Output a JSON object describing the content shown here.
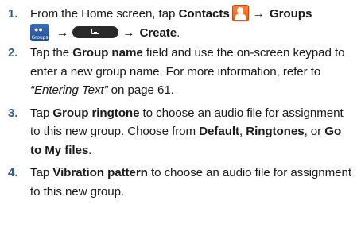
{
  "steps": [
    {
      "number": "1.",
      "from": "From the Home screen, tap ",
      "contacts": "Contacts",
      "arrow": "→",
      "groups": "Groups",
      "groups_icon_label": "Groups",
      "create": "Create",
      "end": "."
    },
    {
      "number": "2.",
      "tap": "Tap the ",
      "field": "Group name",
      "rest": " field and use the on-screen keypad to enter a new group name. For more information, refer to ",
      "ref": "“Entering Text”",
      "page": " on page 61."
    },
    {
      "number": "3.",
      "tap": "Tap ",
      "ringtone": "Group ringtone",
      "rest": " to choose an audio file for assignment to this new group. Choose from ",
      "default": "Default",
      "comma": ",",
      "ringtones": "Ringtones",
      "or": ", or ",
      "myfiles": "Go to My files",
      "end": "."
    },
    {
      "number": "4.",
      "tap": "Tap ",
      "vibration": "Vibration pattern",
      "rest": " to choose an audio file for assignment to this new group."
    }
  ],
  "colors": {
    "step_number": "#2f5f9b",
    "contacts_icon": "#e2561a",
    "groups_icon": "#1f4d8f",
    "menu_key": "#2a2a2a"
  },
  "icons": {
    "contacts": "contacts-icon",
    "groups": "groups-icon",
    "menu": "menu-key-icon"
  }
}
